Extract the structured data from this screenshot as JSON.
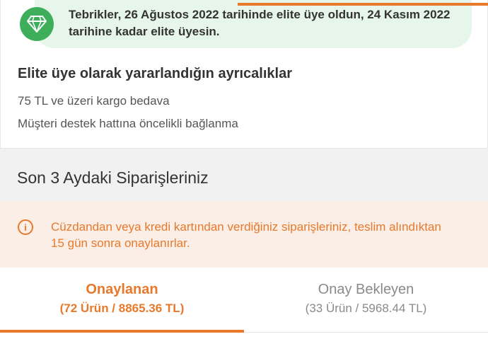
{
  "elite": {
    "congrats_text": "Tebrikler, 26 Ağustos 2022 tarihinde elite üye oldun, 24 Kasım 2022 tarihine kadar elite üyesin.",
    "badge_icon": "diamond-icon",
    "benefits_title": "Elite üye olarak yararlandığın ayrıcalıklar",
    "benefits": [
      "75 TL ve üzeri kargo bedava",
      "Müşteri destek hattına öncelikli bağlanma"
    ]
  },
  "orders": {
    "title": "Son 3 Aydaki Siparişleriniz",
    "info_icon": "info-icon",
    "info_text": "Cüzdandan veya kredi kartından verdiğiniz siparişleriniz, teslim alındıktan 15 gün sonra onaylanırlar.",
    "tabs": [
      {
        "label": "Onaylanan",
        "count": "(72 Ürün / 8865.36 TL)",
        "active": true
      },
      {
        "label": "Onay Bekleyen",
        "count": "(33 Ürün / 5968.44 TL)",
        "active": false
      }
    ]
  },
  "colors": {
    "accent": "#e8792b",
    "success": "#3fae5b",
    "success_bg": "#e6f6ea",
    "info_bg": "#fbeee6"
  }
}
